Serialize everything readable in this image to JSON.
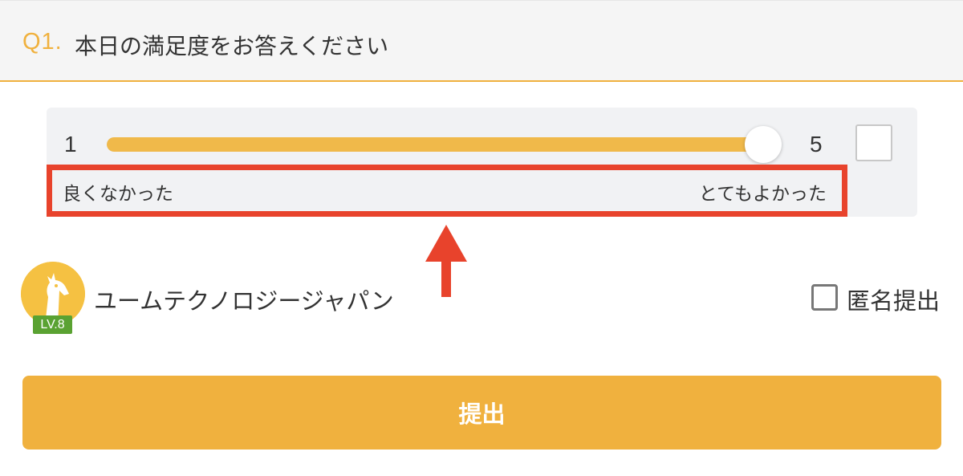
{
  "question": {
    "number": "Q1.",
    "text": "本日の満足度をお答えください"
  },
  "slider": {
    "min_label": "1",
    "max_label": "5",
    "value": 5,
    "min_description": "良くなかった",
    "max_description": "とてもよかった",
    "checkbox_checked": false
  },
  "user": {
    "name": "ユームテクノロジージャパン",
    "level": "LV.8"
  },
  "anonymous": {
    "label": "匿名提出",
    "checked": false
  },
  "submit": {
    "label": "提出"
  },
  "colors": {
    "accent": "#f0b13e",
    "highlight": "#e8432c",
    "level_badge": "#5aa232"
  },
  "icons": [
    "giraffe-avatar-icon",
    "up-arrow-icon",
    "checkbox-icon"
  ]
}
